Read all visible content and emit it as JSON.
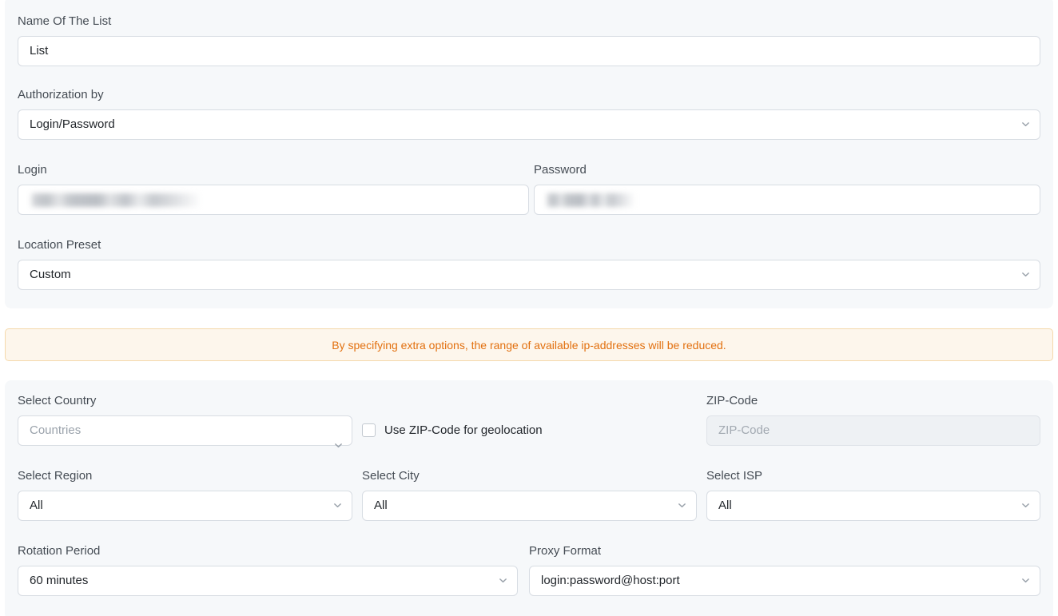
{
  "form": {
    "list_name": {
      "label": "Name Of The List",
      "value": "List"
    },
    "authorization_by": {
      "label": "Authorization by",
      "value": "Login/Password"
    },
    "login": {
      "label": "Login",
      "value": "",
      "redacted": true
    },
    "password": {
      "label": "Password",
      "value": "",
      "redacted": true
    },
    "location_preset": {
      "label": "Location Preset",
      "value": "Custom"
    }
  },
  "warning": {
    "text": "By specifying extra options, the range of available ip-addresses will be reduced.",
    "text_color": "#e2700f",
    "background_color": "#fdf6ec",
    "border_color": "#f5d9ab"
  },
  "options": {
    "select_country": {
      "label": "Select Country",
      "placeholder": "Countries",
      "value": ""
    },
    "use_zip_geolocation": {
      "label": "Use ZIP-Code for geolocation",
      "checked": false
    },
    "zip_code": {
      "label": "ZIP-Code",
      "placeholder": "ZIP-Code",
      "value": "",
      "disabled": true
    },
    "select_region": {
      "label": "Select Region",
      "value": "All"
    },
    "select_city": {
      "label": "Select City",
      "value": "All"
    },
    "select_isp": {
      "label": "Select ISP",
      "value": "All"
    },
    "rotation_period": {
      "label": "Rotation Period",
      "value": "60 minutes"
    },
    "proxy_format": {
      "label": "Proxy Format",
      "value": "login:password@host:port"
    }
  },
  "icons": {
    "chevron_down": "chevron-down-icon"
  }
}
